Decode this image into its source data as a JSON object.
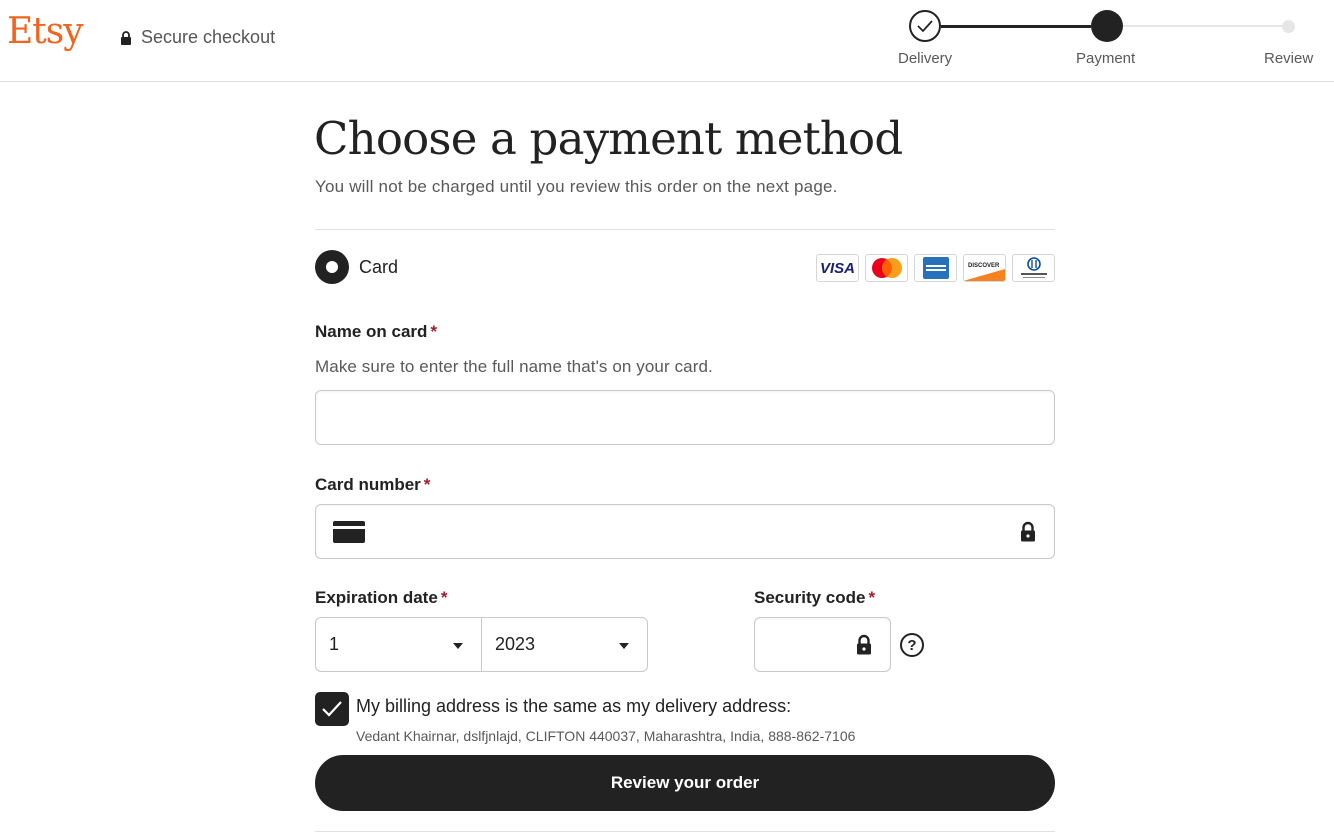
{
  "header": {
    "logo": "Etsy",
    "secure_label": "Secure checkout",
    "steps": [
      {
        "label": "Delivery",
        "state": "done"
      },
      {
        "label": "Payment",
        "state": "active"
      },
      {
        "label": "Review",
        "state": "todo"
      }
    ]
  },
  "main": {
    "title": "Choose a payment method",
    "subtitle": "You will not be charged until you review this order on the next page.",
    "payment_option": {
      "label": "Card",
      "selected": true
    },
    "card_logos": [
      "visa-logo",
      "mastercard-logo",
      "amex-logo",
      "discover-logo",
      "diners-club-logo"
    ],
    "card_logo_text": {
      "visa": "VISA",
      "discover": "DISCOVER"
    },
    "name_field": {
      "label": "Name on card",
      "required_mark": "*",
      "hint": "Make sure to enter the full name that's on your card.",
      "value": ""
    },
    "card_number_field": {
      "label": "Card number",
      "required_mark": "*",
      "value": ""
    },
    "expiration": {
      "label": "Expiration date",
      "required_mark": "*",
      "month": "1",
      "year": "2023"
    },
    "security_code": {
      "label": "Security code",
      "required_mark": "*",
      "value": "",
      "help_symbol": "?"
    },
    "billing": {
      "checked": true,
      "label": "My billing address is the same as my delivery address:",
      "address": "Vedant Khairnar, dslfjnlajd, CLIFTON 440037, Maharashtra, India, 888-862-7106"
    },
    "review_button": "Review your order"
  },
  "colors": {
    "brand": "#f1641e",
    "primary": "#222222",
    "required": "#a61a2e",
    "muted": "#595959",
    "border": "#c9c9c9"
  }
}
